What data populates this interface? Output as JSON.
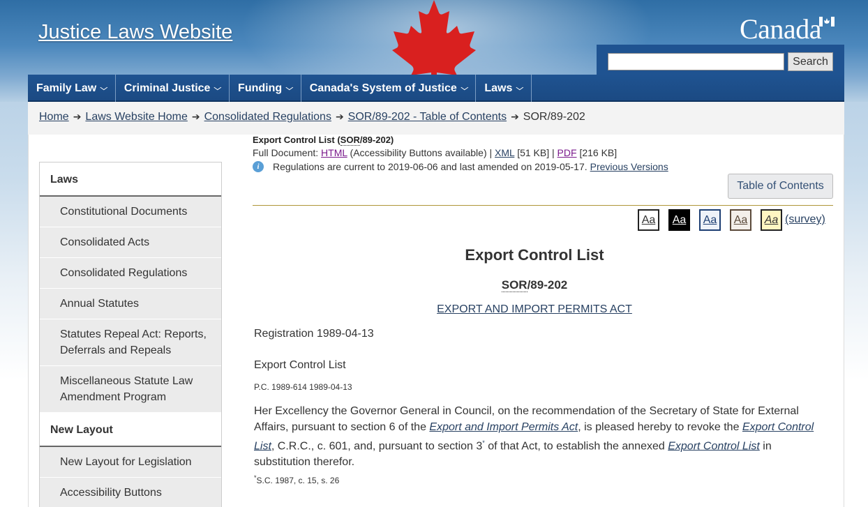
{
  "header": {
    "site_title": "Justice Laws Website",
    "wordmark": "Canada",
    "search_button": "Search",
    "search_placeholder": ""
  },
  "nav": {
    "items": [
      {
        "label": "Family Law"
      },
      {
        "label": "Criminal Justice"
      },
      {
        "label": "Funding"
      },
      {
        "label": "Canada's System of Justice"
      },
      {
        "label": "Laws"
      }
    ]
  },
  "breadcrumb": {
    "home": "Home",
    "laws_home": "Laws Website Home",
    "consolidated": "Consolidated Regulations",
    "toc": "SOR/89-202 -  Table of Contents",
    "current": "SOR/89-202"
  },
  "sidebar": {
    "laws_heading": "Laws",
    "laws_items": [
      {
        "label": "Constitutional Documents"
      },
      {
        "label": "Consolidated Acts"
      },
      {
        "label": "Consolidated Regulations"
      },
      {
        "label": "Annual Statutes"
      },
      {
        "label": "Statutes Repeal Act: Reports, Deferrals and Repeals"
      },
      {
        "label": "Miscellaneous Statute Law Amendment Program"
      }
    ],
    "layout_heading": "New Layout",
    "layout_items": [
      {
        "label": "New Layout for Legislation"
      },
      {
        "label": "Accessibility Buttons"
      }
    ]
  },
  "document": {
    "small_title": "Export Control List (",
    "small_title_abbr": "SOR",
    "small_title_end": "/89-202)",
    "full_doc_label": "Full Document: ",
    "html_link": "HTML",
    "html_note": "(Accessibility Buttons available) |",
    "xml_link": "XML",
    "xml_size": "[51 KB] |",
    "pdf_link": "PDF",
    "pdf_size": "[216 KB]",
    "current_text": "Regulations are current to 2019-06-06 and last amended on 2019-05-17.",
    "previous_versions": "Previous Versions",
    "toc_button": "Table of Contents",
    "aa_label": "Aa",
    "survey": "(survey)",
    "title": "Export Control List",
    "sor_abbr": "SOR",
    "sor_number": "/89-202",
    "act_link": "EXPORT AND IMPORT PERMITS ACT",
    "registration": "Registration 1989-04-13",
    "ecl_heading": "Export Control List",
    "pc": "P.C. 1989-614 1989-04-13",
    "para_1": "Her Excellency the Governor General in Council, on the recommendation of the Secretary of State for External Affairs, pursuant to section 6 of the ",
    "para_act": "Export and Import Permits Act",
    "para_2": ", is pleased hereby to revoke the ",
    "para_ecl1": "Export Control List",
    "para_3": ", C.R.C., c. 601, and, pursuant to section 3",
    "para_fnref": "*",
    "para_4": " of that Act, to establish the annexed ",
    "para_ecl2": "Export Control List",
    "para_5": " in substitution therefor.",
    "footnote_mark": "*",
    "footnote": "S.C. 1987, c. 15, s. 26"
  },
  "colors": {
    "nav_bg": "#1f5391",
    "link": "#284162",
    "visited_link": "#7a1a8c",
    "rule": "#af9637"
  }
}
